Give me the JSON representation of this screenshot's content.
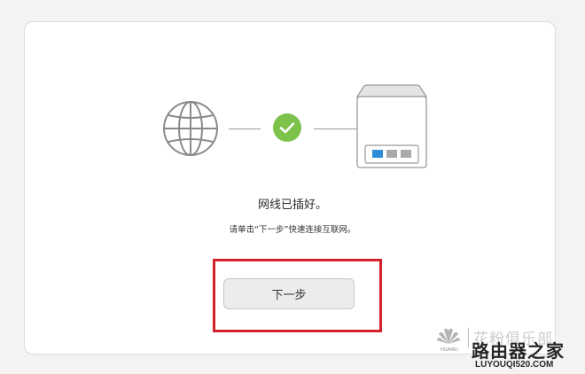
{
  "status": {
    "title": "网线已插好。",
    "hint": "请单击“下一步”快速连接互联网。"
  },
  "actions": {
    "next_label": "下一步"
  },
  "icons": {
    "globe": "globe-icon",
    "check": "check-circle-icon",
    "router": "router-icon"
  },
  "colors": {
    "check_green": "#7cc24b",
    "port_active": "#2d8ed8",
    "port_idle": "#a9a9a9",
    "highlight_red": "#d4222b"
  },
  "watermark": {
    "brand": "HUAWEI",
    "club": "花粉俱乐部",
    "site_cn": "路由器之家",
    "site_url": "LUYOUQI520.COM"
  }
}
